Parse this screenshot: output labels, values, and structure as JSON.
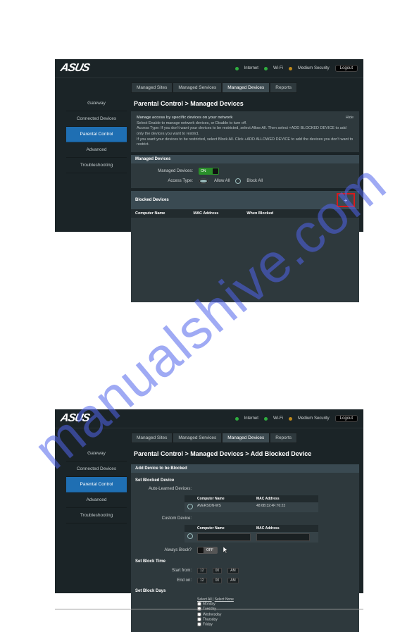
{
  "watermark": "manualshive.com",
  "common": {
    "logo": "ASUS",
    "status_internet": "Internet",
    "status_wifi": "Wi-Fi",
    "status_security": "Medium Security",
    "logout": "Logout",
    "tabs": [
      "Managed Sites",
      "Managed Services",
      "Managed Devices",
      "Reports"
    ],
    "sidebar": [
      "Gateway",
      "Connected Devices",
      "Parental Control",
      "Advanced",
      "Troubleshooting"
    ]
  },
  "shot1": {
    "breadcrumb": "Parental Control > Managed Devices",
    "info_line1": "Manage access by specific devices on your network",
    "info_line2": "Select Enable to manage network devices, or Disable to turn off.",
    "info_line3": "Access Type: If you don't want your devices to be restricted, select Allow All. Then select +ADD BLOCKED DEVICE to add only the devices you want to restrict.",
    "info_line4": "If you want your devices to be restricted, select Block All. Click +ADD ALLOWED DEVICE to add the devices you don't want to restrict.",
    "hide": "Hide",
    "section_managed": "Managed Devices",
    "label_managed_devices": "Managed Devices:",
    "toggle_on": "ON",
    "label_access_type": "Access Type:",
    "radio_allow": "Allow All",
    "radio_block": "Block All",
    "section_blocked": "Blocked Devices",
    "add_icon": "+",
    "th_computer": "Computer Name",
    "th_mac": "MAC Address",
    "th_when": "When Blocked",
    "th_blank": ""
  },
  "shot2": {
    "breadcrumb": "Parental Control > Managed Devices > Add Blocked Device",
    "section_add": "Add Device to be Blocked",
    "grp_set_blocked": "Set Blocked Device",
    "label_auto": "Auto-Learned Devices:",
    "th_computer": "Computer Name",
    "th_mac": "MAC Address",
    "row_radio_name": "AVERSON-WS",
    "row_radio_mac": "48:6B:32:4F:76:23",
    "label_custom": "Custom Device:",
    "label_always": "Always Block?",
    "toggle_off": "OFF",
    "grp_set_time": "Set Block Time",
    "label_start": "Start from:",
    "label_end": "End on:",
    "time_h": "12",
    "time_m": "00",
    "time_ampm": "AM",
    "grp_set_days": "Set Block Days",
    "select_all": "Select All",
    "select_none": "Select None",
    "days": [
      "Monday",
      "Tuesday",
      "Wednesday",
      "Thursday",
      "Friday"
    ]
  }
}
